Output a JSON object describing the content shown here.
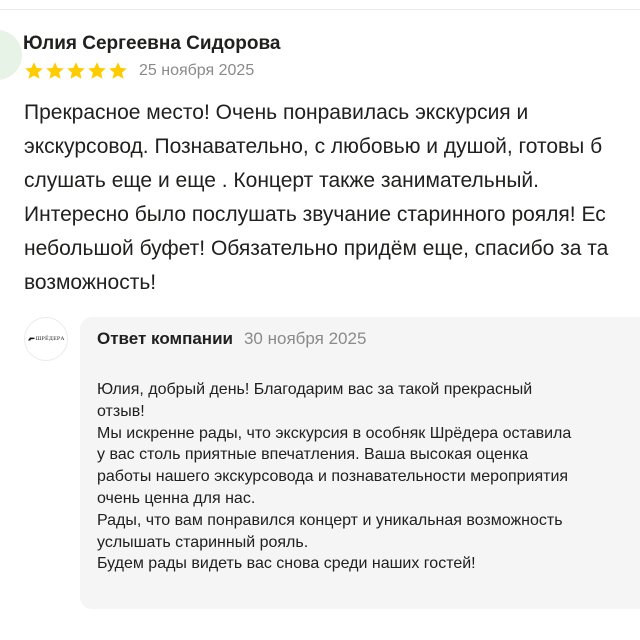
{
  "review": {
    "author_name": "Юлия Сергеевна Сидорова",
    "rating": 5,
    "rating_max": 5,
    "star_color": "#fc0",
    "date": "25 ноября 2025",
    "text_lines": [
      "Прекрасное место! Очень понравилась экскурсия и",
      "экскурсовод. Познавательно, с любовью и душой, готовы б",
      "слушать еще и еще . Концерт также занимательный.",
      "Интересно было послушать звучание старинного рояля! Ес",
      "небольшой буфет! Обязательно придём еще, спасибо за та",
      "возможность!"
    ]
  },
  "reply": {
    "logo_text": "ШРЁДЕРА",
    "header_label": "Ответ компании",
    "date": "30 ноября 2025",
    "text_lines": [
      "Юлия, добрый день! Благодарим вас за такой прекрасный",
      "отзыв!",
      "Мы искренне рады, что экскурсия в особняк Шрёдера оставила",
      "у вас столь приятные впечатления. Ваша высокая оценка",
      "работы нашего экскурсовода и познавательности мероприятия",
      "очень ценна для нас.",
      "Рады, что вам понравился концерт и уникальная возможность",
      "услышать старинный рояль.",
      "Будем рады видеть вас снова среди наших гостей!"
    ]
  },
  "icons": {
    "star": "star-icon",
    "logo_mark": "piano-mark-icon"
  }
}
